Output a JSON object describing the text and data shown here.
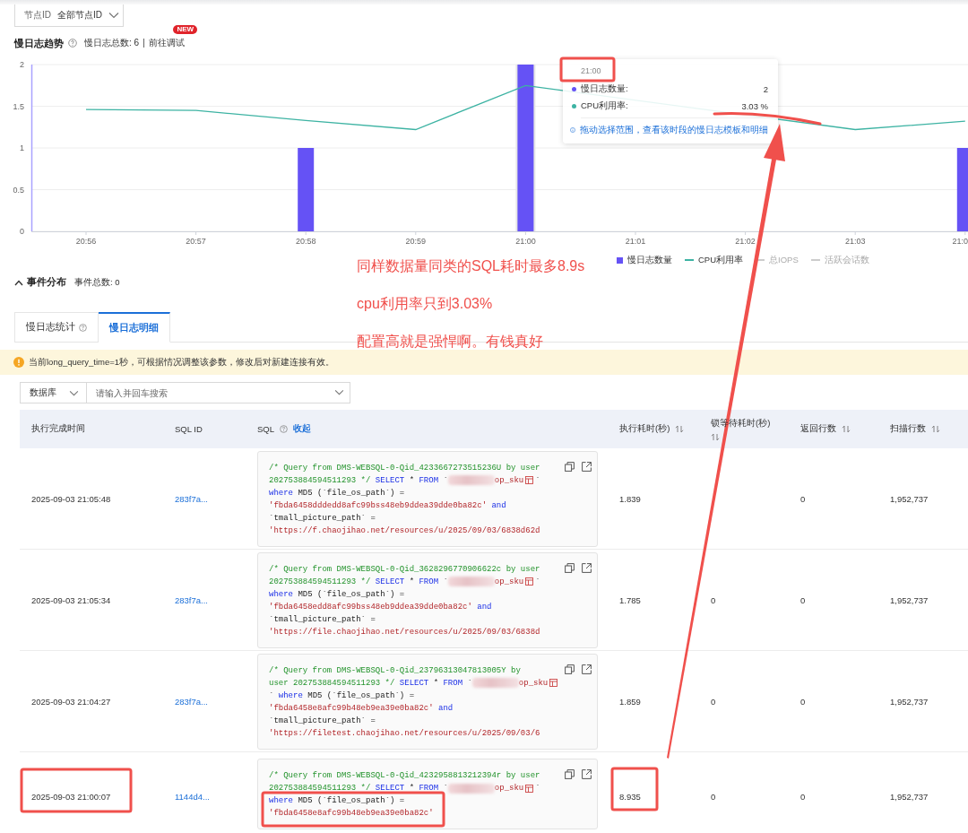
{
  "node_filter": {
    "label": "节点ID",
    "value": "全部节点ID"
  },
  "trend": {
    "title": "慢日志趋势",
    "total": "慢日志总数: 6",
    "link": "前往调试",
    "badge": "NEW",
    "chart_data": {
      "type": "bar",
      "grid": true,
      "categories": [
        "20:56",
        "20:57",
        "20:58",
        "20:59",
        "21:00",
        "21:01",
        "21:02",
        "21:03",
        "21:0"
      ],
      "yticks": [
        0,
        0.5,
        1,
        1.5,
        2
      ],
      "ylim": [
        0,
        2
      ],
      "series": [
        {
          "name": "慢日志数量",
          "color": "#6552f5",
          "type": "bar",
          "values": [
            null,
            null,
            1,
            null,
            2,
            null,
            null,
            null,
            1
          ]
        },
        {
          "name": "CPU利用率",
          "color": "#3db3a3",
          "type": "line",
          "values": [
            1.46,
            1.45,
            1.33,
            1.22,
            1.75,
            null,
            null,
            1.22,
            1.32
          ]
        }
      ]
    },
    "legend_extra": [
      {
        "label": "总IOPS",
        "on": false
      },
      {
        "label": "活跃会话数",
        "on": false
      }
    ],
    "tooltip": {
      "time": "21:00",
      "rows": [
        {
          "label": "慢日志数量:",
          "value": "2",
          "color": "#6552f5"
        },
        {
          "label": "CPU利用率:",
          "value": "3.03 %",
          "color": "#3db3a3"
        }
      ],
      "hint": "拖动选择范围，查看该时段的慢日志模板和明细"
    }
  },
  "events": {
    "title": "事件分布",
    "total": "事件总数: 0",
    "expanded": true
  },
  "tabs": [
    {
      "label": "慢日志统计",
      "help": true,
      "selected": false
    },
    {
      "label": "慢日志明细",
      "help": false,
      "selected": true
    }
  ],
  "notice": "当前long_query_time=1秒，可根据情况调整该参数，修改后对新建连接有效。",
  "search": {
    "scope": "数据库",
    "placeholder": "请输入并回车搜索"
  },
  "table": {
    "columns": [
      {
        "label": "执行完成时间"
      },
      {
        "label": "SQL ID"
      },
      {
        "label": "SQL",
        "help": true,
        "action": "收起"
      },
      {
        "label": "执行耗时(秒)",
        "sortable": true
      },
      {
        "label": "锁等待耗时(秒)",
        "sortable": true
      },
      {
        "label": "返回行数",
        "sortable": true
      },
      {
        "label": "扫描行数",
        "sortable": true
      }
    ],
    "rows": [
      {
        "finished": "2025-09-03 21:05:48",
        "sql_id": "283f7a...",
        "duration": "1.839",
        "rows_returned": "0",
        "rows_scanned": "1,952,737",
        "sql": [
          [
            {
              "kind": "comment",
              "text": "/* Query from DMS-WEBSQL-0-Qid_4233667273515236U by user"
            }
          ],
          [
            {
              "kind": "comment",
              "text": "202753884594511293 */ "
            },
            {
              "kind": "keyword",
              "text": "SELECT"
            },
            {
              "kind": "plain",
              "text": " * "
            },
            {
              "kind": "keyword",
              "text": "FROM"
            },
            {
              "kind": "plain",
              "text": " `"
            },
            {
              "kind": "redacted"
            },
            {
              "kind": "string",
              "text": "op_sku"
            },
            {
              "kind": "table_icon"
            },
            {
              "kind": "plain",
              "text": "`"
            }
          ],
          [
            {
              "kind": "keyword",
              "text": "where"
            },
            {
              "kind": "plain",
              "text": " MD5 (`file_os_path`) ="
            }
          ],
          [
            {
              "kind": "string",
              "text": "'fbda6458dddedd8afc99bss48eb9ddea39dde0ba82c'"
            },
            {
              "kind": "keyword",
              "text": " and"
            }
          ],
          [
            {
              "kind": "plain",
              "text": "`tmall_picture_path` ="
            }
          ],
          [
            {
              "kind": "string",
              "text": "'https://f.chaojihao.net/resources/u/2025/09/03/6838d62d"
            }
          ]
        ]
      },
      {
        "finished": "2025-09-03 21:05:34",
        "sql_id": "283f7a...",
        "duration": "1.785",
        "lock_wait": "0",
        "rows_returned": "0",
        "rows_scanned": "1,952,737",
        "sql": [
          [
            {
              "kind": "comment",
              "text": "/* Query from DMS-WEBSQL-0-Qid_3628296770906622c by user"
            }
          ],
          [
            {
              "kind": "comment",
              "text": "202753884594511293 */ "
            },
            {
              "kind": "keyword",
              "text": "SELECT"
            },
            {
              "kind": "plain",
              "text": " * "
            },
            {
              "kind": "keyword",
              "text": "FROM"
            },
            {
              "kind": "plain",
              "text": " `"
            },
            {
              "kind": "redacted"
            },
            {
              "kind": "string",
              "text": "op_sku"
            },
            {
              "kind": "table_icon"
            },
            {
              "kind": "plain",
              "text": "`"
            }
          ],
          [
            {
              "kind": "keyword",
              "text": "where"
            },
            {
              "kind": "plain",
              "text": " MD5 (`file_os_path`) ="
            }
          ],
          [
            {
              "kind": "string",
              "text": "'fbda6458edd8afc99bss48eb9ddea39dde0ba82c'"
            },
            {
              "kind": "keyword",
              "text": " and"
            }
          ],
          [
            {
              "kind": "plain",
              "text": "`tmall_picture_path` ="
            }
          ],
          [
            {
              "kind": "string",
              "text": "'https://file.chaojihao.net/resources/u/2025/09/03/6838d"
            }
          ]
        ]
      },
      {
        "finished": "2025-09-03 21:04:27",
        "sql_id": "283f7a...",
        "duration": "1.859",
        "lock_wait": "0",
        "rows_returned": "0",
        "rows_scanned": "1,952,737",
        "sql": [
          [
            {
              "kind": "comment",
              "text": "/* Query from DMS-WEBSQL-0-Qid_23796313047813005Y by"
            }
          ],
          [
            {
              "kind": "comment",
              "text": "user 202753884594511293 */ "
            },
            {
              "kind": "keyword",
              "text": "SELECT"
            },
            {
              "kind": "plain",
              "text": " * "
            },
            {
              "kind": "keyword",
              "text": "FROM"
            },
            {
              "kind": "plain",
              "text": " `"
            },
            {
              "kind": "redacted"
            },
            {
              "kind": "string",
              "text": "op_sku"
            },
            {
              "kind": "table_icon"
            }
          ],
          [
            {
              "kind": "plain",
              "text": "` "
            },
            {
              "kind": "keyword",
              "text": "where"
            },
            {
              "kind": "plain",
              "text": " MD5 (`file_os_path`) ="
            }
          ],
          [
            {
              "kind": "string",
              "text": "'fbda6458e8afc99b48eb9ea39e0ba82c'"
            },
            {
              "kind": "keyword",
              "text": " and"
            }
          ],
          [
            {
              "kind": "plain",
              "text": "`tmall_picture_path` ="
            }
          ],
          [
            {
              "kind": "string",
              "text": "'https://filetest.chaojihao.net/resources/u/2025/09/03/6"
            }
          ]
        ]
      },
      {
        "finished": "2025-09-03 21:00:07",
        "sql_id": "1144d4...",
        "duration": "8.935",
        "lock_wait": "0",
        "rows_returned": "0",
        "rows_scanned": "1,952,737",
        "sql": [
          [
            {
              "kind": "comment",
              "text": "/* Query from DMS-WEBSQL-0-Qid_4232958813212394r by user"
            }
          ],
          [
            {
              "kind": "comment",
              "text": "202753884594511293 */ "
            },
            {
              "kind": "keyword",
              "text": "SELECT"
            },
            {
              "kind": "plain",
              "text": " * "
            },
            {
              "kind": "keyword",
              "text": "FROM"
            },
            {
              "kind": "plain",
              "text": " `"
            },
            {
              "kind": "redacted"
            },
            {
              "kind": "string",
              "text": "op_sku"
            },
            {
              "kind": "table_icon"
            },
            {
              "kind": "plain",
              "text": "`"
            }
          ],
          [
            {
              "kind": "keyword",
              "text": "where"
            },
            {
              "kind": "plain",
              "text": " MD5 (`file_os_path`) ="
            }
          ],
          [
            {
              "kind": "string",
              "text": "'fbda6458e8afc99b48eb9ea39e0ba82c'"
            }
          ]
        ]
      }
    ]
  },
  "annotations": [
    "同样数据量同类的SQL耗时最多8.9s",
    "cpu利用率只到3.03%",
    "配置高就是强悍啊。有钱真好"
  ]
}
